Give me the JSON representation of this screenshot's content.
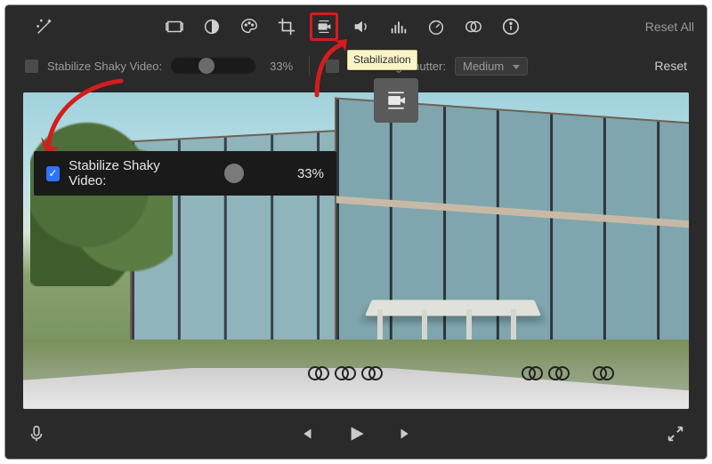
{
  "toolbar": {
    "reset_all": "Reset All"
  },
  "tooltip": {
    "stabilization": "Stabilization"
  },
  "settings": {
    "stabilize_label": "Stabilize Shaky Video:",
    "stabilize_percent": "33%",
    "rolling_label": "Fix Rolling Shutter:",
    "rolling_value": "Medium",
    "reset": "Reset"
  },
  "callout_checked": {
    "label": "Stabilize Shaky Video:",
    "percent": "33%"
  },
  "icons": {
    "wand": "magic-wand-icon",
    "frame": "frame-icon",
    "contrast": "contrast-icon",
    "palette": "palette-icon",
    "crop": "crop-icon",
    "camera": "camera-stabilization-icon",
    "volume": "volume-icon",
    "eq": "equalizer-icon",
    "speed": "speed-icon",
    "overlap": "clip-filter-icon",
    "info": "info-icon",
    "mic": "microphone-icon",
    "prev": "previous-icon",
    "play": "play-icon",
    "next": "next-icon",
    "expand": "expand-icon"
  }
}
